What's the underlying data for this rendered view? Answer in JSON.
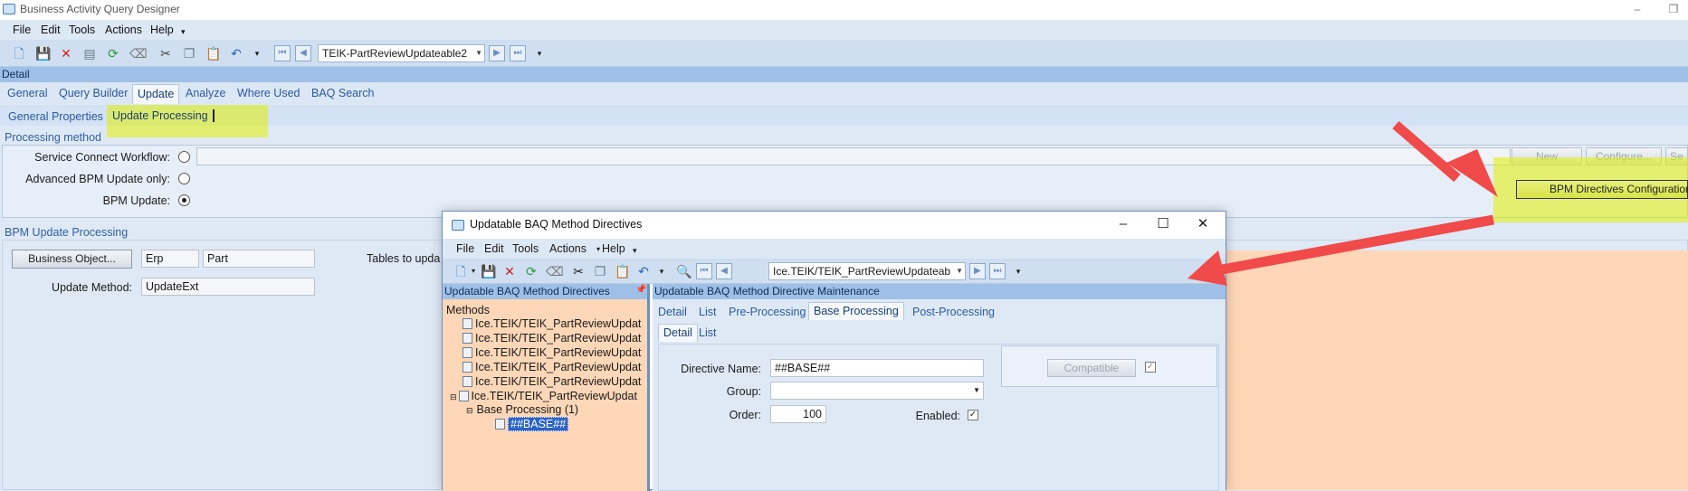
{
  "window": {
    "title": "Business Activity Query Designer"
  },
  "menu": [
    "File",
    "Edit",
    "Tools",
    "Actions",
    "Help"
  ],
  "toolbar": {
    "query_combo": "TEIK-PartReviewUpdateable2"
  },
  "detail_label": "Detail",
  "tabs": [
    "General",
    "Query Builder",
    "Update",
    "Analyze",
    "Where Used",
    "BAQ Search"
  ],
  "active_tab": "Update",
  "subtabs": [
    "General Properties",
    "Update Processing"
  ],
  "processing": {
    "section": "Processing method",
    "service_connect_label": "Service Connect Workflow:",
    "advanced_label": "Advanced BPM Update only:",
    "bpm_label": "BPM Update:",
    "selected": "bpm",
    "new_btn": "New",
    "configure_btn": "Configure...",
    "se_btn": "Se",
    "bpm_config_btn": "BPM Directives Configuration ..."
  },
  "bpm_update": {
    "section": "BPM Update Processing",
    "business_object_btn": "Business Object...",
    "erp": "Erp",
    "part": "Part",
    "tables_label": "Tables to upda",
    "update_method_label": "Update Method:",
    "update_method": "UpdateExt"
  },
  "dialog": {
    "title": "Updatable BAQ Method Directives",
    "menu": [
      "File",
      "Edit",
      "Tools",
      "Actions",
      "Help"
    ],
    "combo": "Ice.TEIK/TEIK_PartReviewUpdateab",
    "left_header": "Updatable BAQ Method Directives",
    "right_header": "Updatable BAQ Method Directive Maintenance",
    "tree": {
      "root": "Methods",
      "items": [
        "Ice.TEIK/TEIK_PartReviewUpdat",
        "Ice.TEIK/TEIK_PartReviewUpdat",
        "Ice.TEIK/TEIK_PartReviewUpdat",
        "Ice.TEIK/TEIK_PartReviewUpdat",
        "Ice.TEIK/TEIK_PartReviewUpdat",
        "Ice.TEIK/TEIK_PartReviewUpdat"
      ],
      "group": "Base Processing (1)",
      "leaf": "##BASE##"
    },
    "tabs": [
      "Detail",
      "List",
      "Pre-Processing",
      "Base Processing",
      "Post-Processing"
    ],
    "active_tab": "Base Processing",
    "subtabs": [
      "Detail",
      "List"
    ],
    "form": {
      "directive_name_label": "Directive Name:",
      "directive_name": "##BASE##",
      "group_label": "Group:",
      "group": "",
      "order_label": "Order:",
      "order": "100",
      "enabled_label": "Enabled:",
      "enabled": "✓",
      "compatible_btn": "Compatible",
      "compatible_check": "✓"
    }
  },
  "colors": {
    "highlight": "#e2f000",
    "arrow": "#f04a4a",
    "orange": "#fdd7b7"
  }
}
